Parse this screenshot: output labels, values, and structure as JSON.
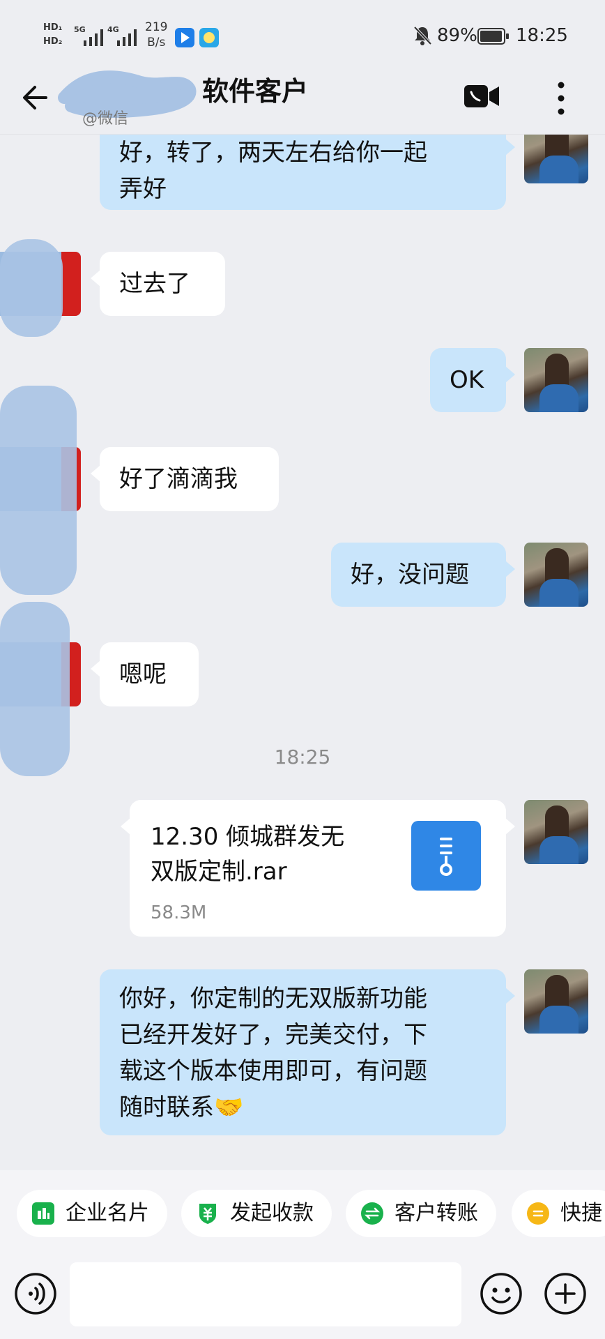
{
  "status_bar": {
    "hd_top": "HD₁",
    "hd_bottom": "HD₂",
    "sig1": "5G",
    "sig2": "4G",
    "speed_value": "219",
    "speed_unit": "B/s",
    "battery": "89%",
    "time": "18:25"
  },
  "header": {
    "title": "软件客户",
    "subtitle": "@微信",
    "icons": [
      "back-arrow-icon",
      "video-call-icon",
      "more-vertical-icon"
    ]
  },
  "messages": [
    {
      "side": "out",
      "lines": [
        "好，转了，两天左右给你一起",
        "弄好"
      ]
    },
    {
      "side": "in",
      "text": "过去了"
    },
    {
      "side": "out",
      "text": "OK"
    },
    {
      "side": "in",
      "text": "好了滴滴我"
    },
    {
      "side": "out",
      "text": "好，没问题"
    },
    {
      "side": "in",
      "text": "嗯呢"
    },
    {
      "type": "time",
      "text": "18:25"
    },
    {
      "side": "out",
      "type": "file",
      "name_lines": [
        "12.30 倾城群发无",
        "双版定制.rar"
      ],
      "size": "58.3M"
    },
    {
      "side": "out",
      "lines": [
        "你好，你定制的无双版新功能",
        "已经开发好了，完美交付，下",
        "载这个版本使用即可，有问题",
        "随时联系🤝"
      ]
    }
  ],
  "quick_actions": [
    {
      "label": "企业名片",
      "icon": "business-card-icon",
      "color": "#19b14c"
    },
    {
      "label": "发起收款",
      "icon": "payment-request-icon",
      "color": "#19b14c"
    },
    {
      "label": "客户转账",
      "icon": "transfer-icon",
      "color": "#19b14c"
    },
    {
      "label": "快捷",
      "icon": "quick-reply-icon",
      "color": "#f6b716"
    }
  ],
  "input": {
    "placeholder": ""
  },
  "colors": {
    "outgoing_bubble": "#c9e5fb",
    "incoming_bubble": "#ffffff",
    "background": "#edeef2",
    "file_icon": "#2f87e6"
  }
}
